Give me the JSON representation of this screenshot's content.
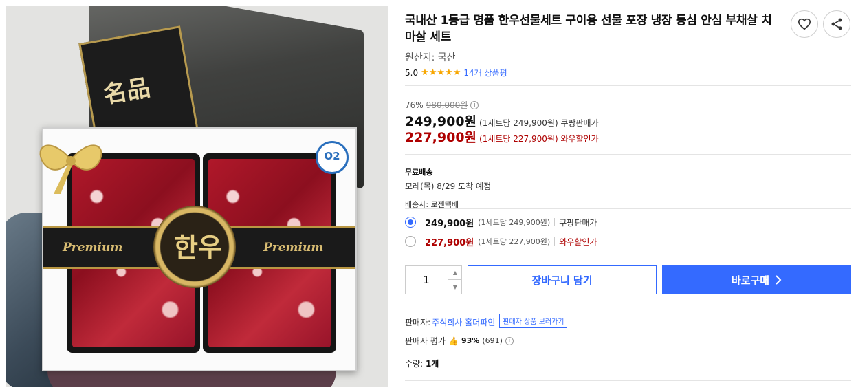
{
  "product": {
    "title": "국내산 1등급 명품 한우선물세트 구이용 선물 포장 냉장 등심 안심 부채살 치마살 세트",
    "origin": "원산지: 국산",
    "rating_score": "5.0",
    "rating_stars": 5,
    "review_link": "14개 상품평"
  },
  "image": {
    "bag_mark": "名品",
    "seal_text": "한우",
    "band_word_left": "Premium",
    "band_word_right": "Premium",
    "badge_text": "O2"
  },
  "pricing": {
    "discount_rate": "76%",
    "original_price": "980,000원",
    "coupang_price": "249,900원",
    "coupang_note": "(1세트당 249,900원) 쿠팡판매가",
    "wow_price": "227,900원",
    "wow_note": "(1세트당 227,900원) 와우할인가"
  },
  "shipping": {
    "label": "무료배송",
    "eta": "모레(목) 8/29 도착 예정",
    "carrier": "배송사: 로젠택배"
  },
  "options": [
    {
      "price": "249,900원",
      "note": "(1세트당 249,900원)",
      "type": "쿠팡판매가",
      "selected": true
    },
    {
      "price": "227,900원",
      "note": "(1세트당 227,900원)",
      "type": "와우할인가",
      "selected": false
    }
  ],
  "purchase": {
    "quantity": "1",
    "cart_label": "장바구니 담기",
    "buy_label": "바로구매"
  },
  "seller": {
    "label": "판매자:",
    "name": "주식회사 홀더파인",
    "tag": "판매자 상품 보러가기",
    "rating_label": "판매자 평가",
    "rating_pct": "93%",
    "rating_count": "(691)"
  },
  "summary": {
    "quantity_label": "수량:",
    "quantity_value": "1개"
  },
  "colors": {
    "accent_blue": "#346aff",
    "wow_red": "#ae0000",
    "star": "#f7a600"
  }
}
